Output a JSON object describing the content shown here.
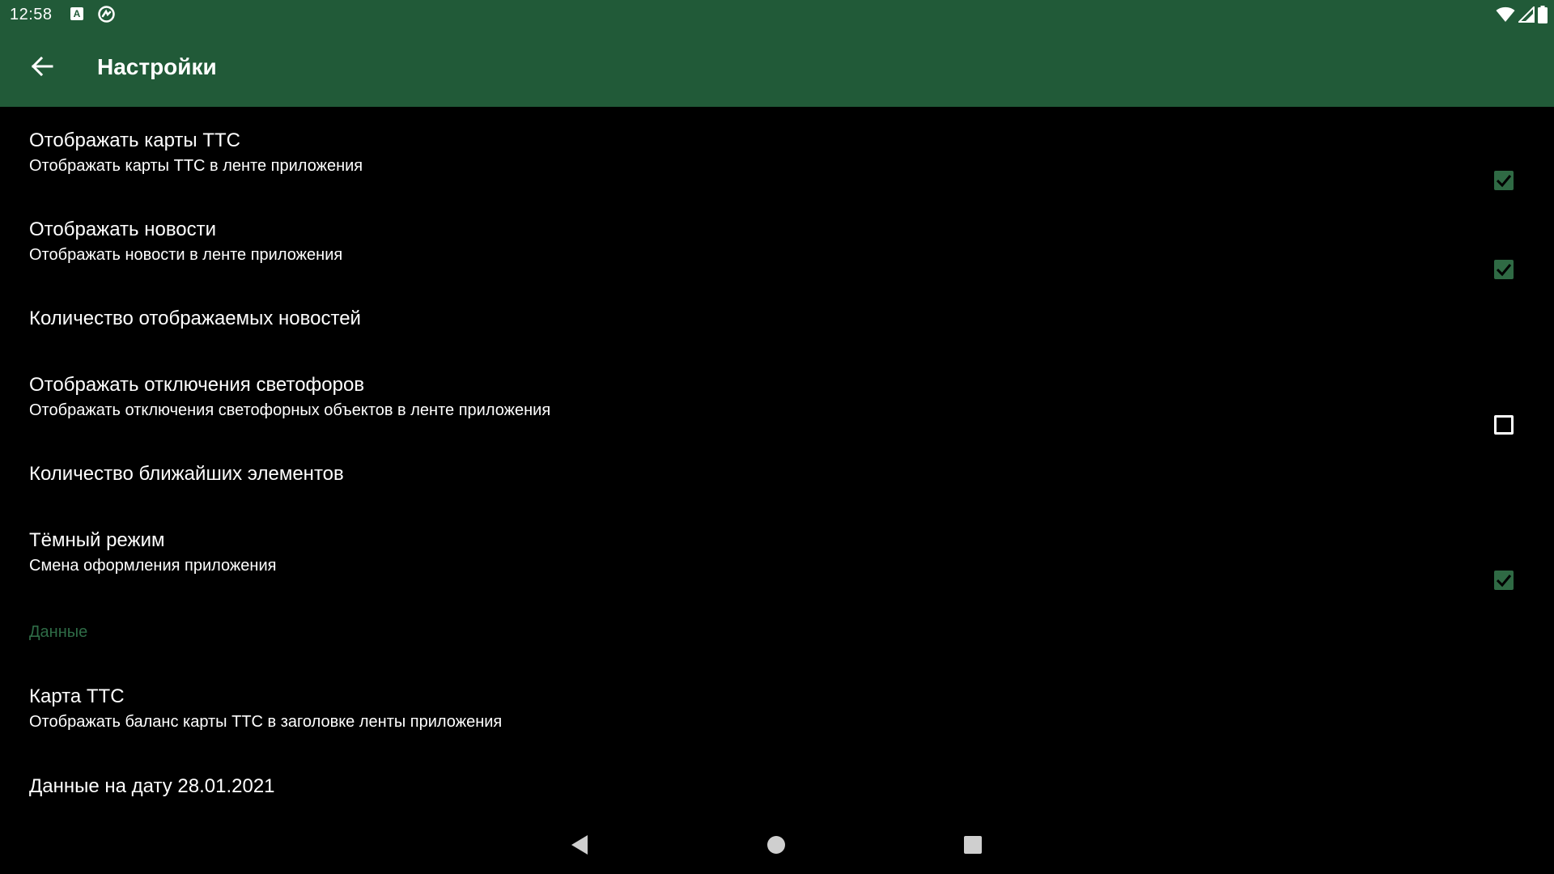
{
  "status_bar": {
    "time": "12:58",
    "notification_icon_a_letter": "A",
    "icons": [
      "text-notification-icon",
      "sync-icon",
      "wifi-icon",
      "signal-icon",
      "battery-icon"
    ]
  },
  "app_bar": {
    "title": "Настройки",
    "background_color": "#215a38",
    "back_icon": "arrow-back-icon"
  },
  "preferences": [
    {
      "title": "Отображать карты ТТС",
      "summary": "Отображать карты ТТС в ленте приложения",
      "checkbox": "checked"
    },
    {
      "title": "Отображать новости",
      "summary": "Отображать новости в ленте приложения",
      "checkbox": "checked"
    },
    {
      "title": "Количество отображаемых новостей",
      "summary": "",
      "checkbox": "none"
    },
    {
      "title": "Отображать отключения светофоров",
      "summary": "Отображать отключения светофорных объектов в ленте приложения",
      "checkbox": "unchecked"
    },
    {
      "title": "Количество ближайших элементов",
      "summary": "",
      "checkbox": "none"
    },
    {
      "title": "Тёмный режим",
      "summary": "Смена оформления приложения",
      "checkbox": "checked"
    }
  ],
  "data_category": {
    "title": "Данные",
    "color": "#2e6b46",
    "items": [
      {
        "title": "Карта ТТС",
        "summary": "Отображать баланс карты ТТС в заголовке ленты приложения"
      },
      {
        "title": "Данные на дату 28.01.2021",
        "summary": ""
      }
    ]
  },
  "nav_bar": {
    "buttons": [
      "back-triangle-icon",
      "home-circle-icon",
      "recents-square-icon"
    ]
  },
  "colors": {
    "accent": "#2f6a44",
    "background": "#000000",
    "text": "#ffffff"
  }
}
